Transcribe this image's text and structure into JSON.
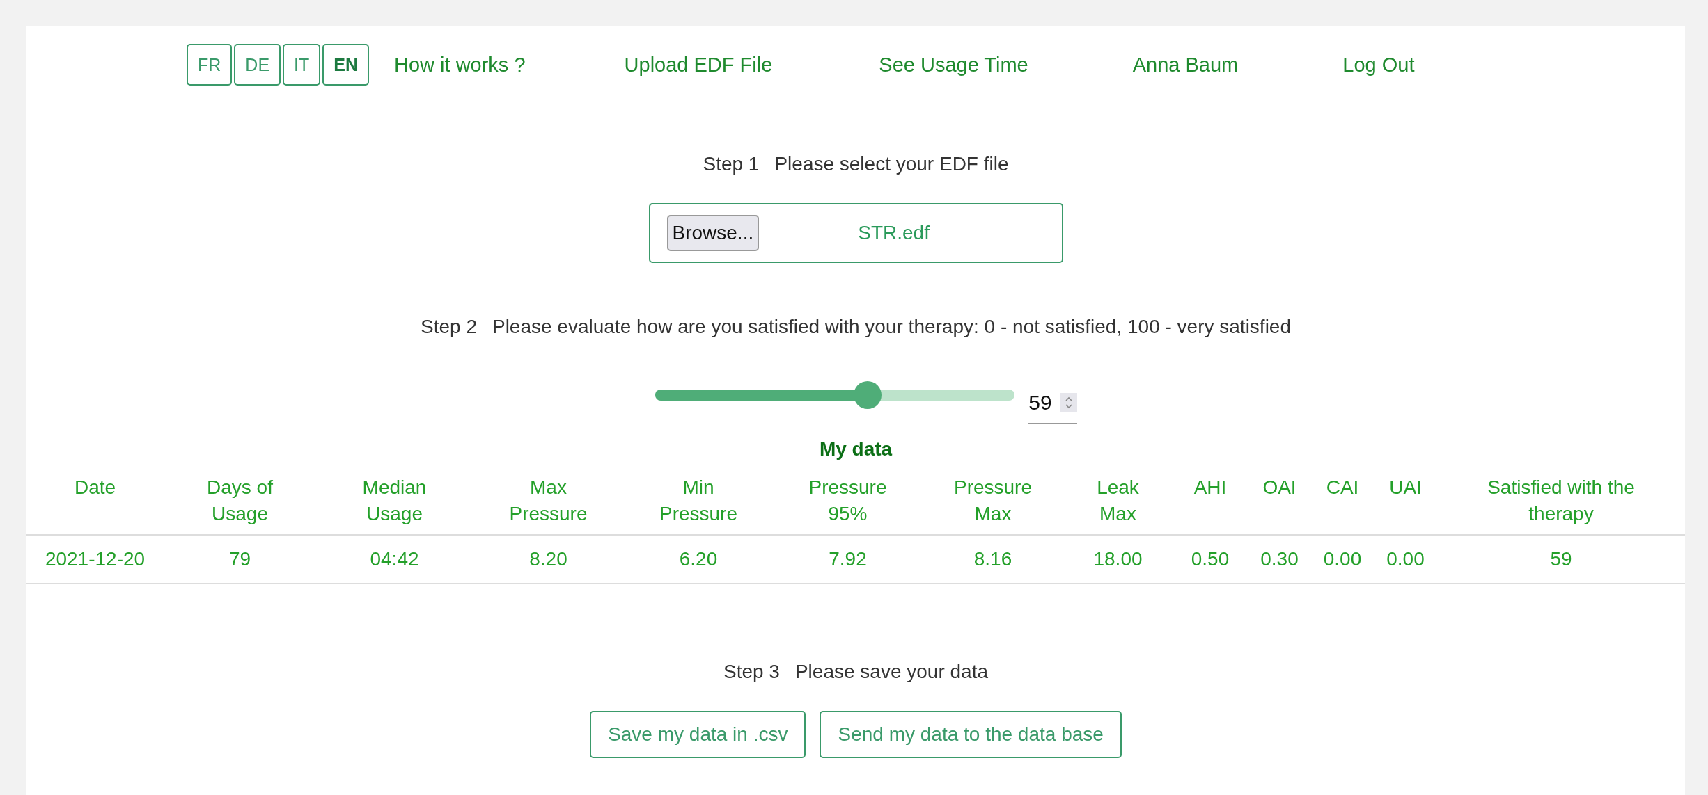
{
  "languages": [
    {
      "label": "FR",
      "selected": false
    },
    {
      "label": "DE",
      "selected": false
    },
    {
      "label": "IT",
      "selected": false
    },
    {
      "label": "EN",
      "selected": true
    }
  ],
  "nav": [
    "How it works ?",
    "Upload EDF File",
    "See Usage Time",
    "Anna Baum",
    "Log Out"
  ],
  "step1": {
    "step": "Step 1",
    "text": "Please select your EDF file",
    "browse_button": "Browse...",
    "file_name": "STR.edf"
  },
  "step2": {
    "step": "Step 2",
    "text": "Please evaluate how are you satisfied with your therapy: 0 - not satisfied, 100 - very satisfied",
    "slider": {
      "level": 0.59
    },
    "value": "59"
  },
  "table": {
    "title": "My data",
    "columns": [
      "Date",
      "Days of Usage",
      "Median Usage",
      "Max Pressure",
      "Min Pressure",
      "Pressure 95%",
      "Pressure Max",
      "Leak Max",
      "AHI",
      "OAI",
      "CAI",
      "UAI",
      "Satisfied with the therapy"
    ],
    "rows": [
      [
        "2021-12-20",
        "79",
        "04:42",
        "8.20",
        "6.20",
        "7.92",
        "8.16",
        "18.00",
        "0.50",
        "0.30",
        "0.00",
        "0.00",
        "59"
      ]
    ]
  },
  "step3": {
    "step": "Step 3",
    "text": "Please save your data",
    "buttons": [
      "Save my data in .csv",
      "Send my data to the data base"
    ]
  }
}
